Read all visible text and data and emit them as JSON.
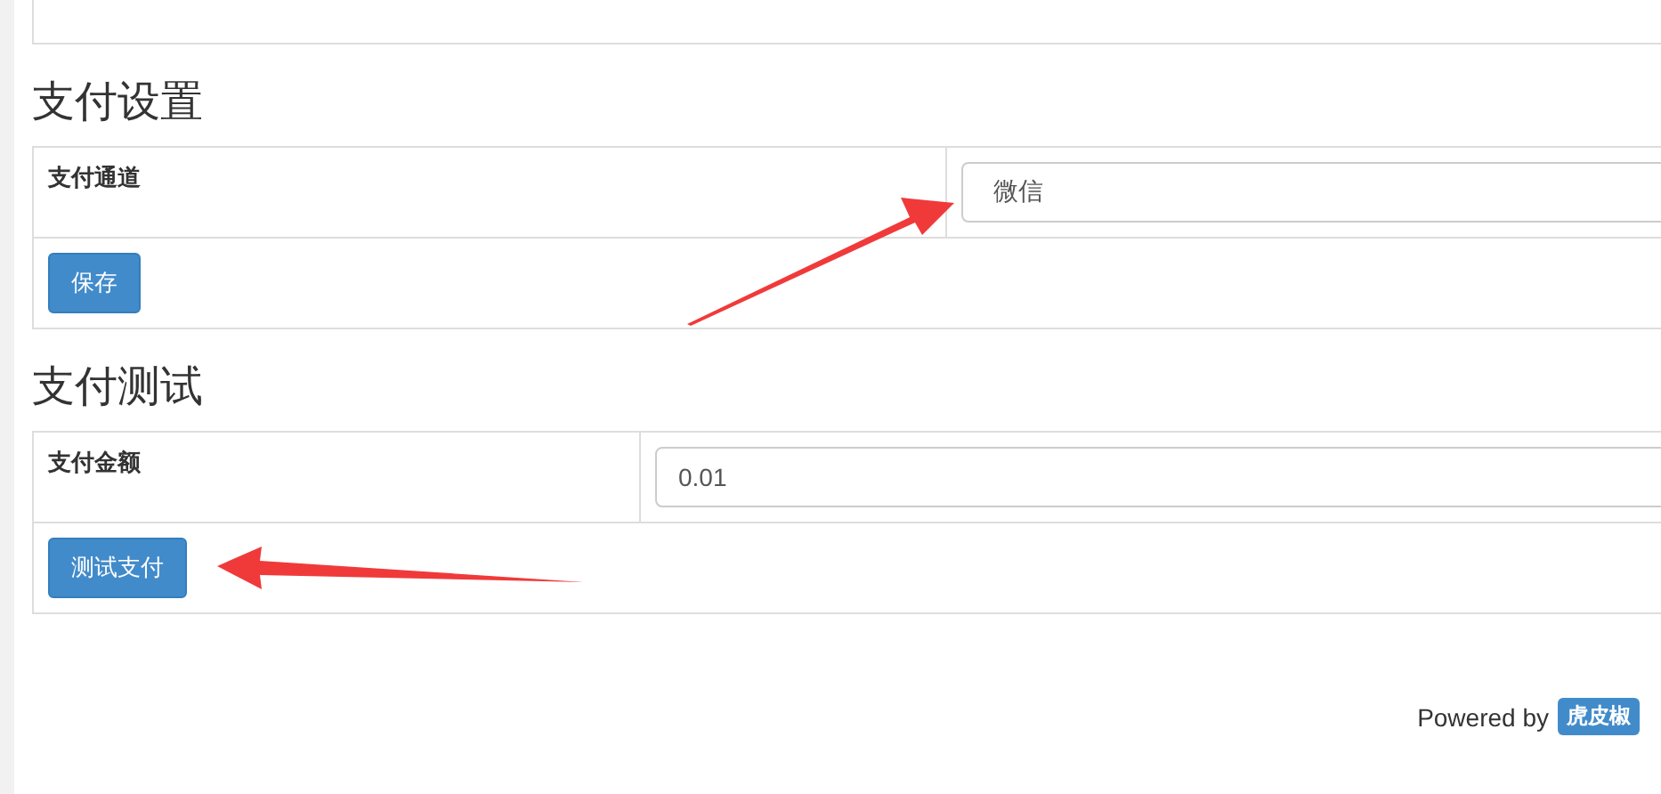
{
  "sections": [
    {
      "title": "支付设置",
      "rows": [
        {
          "label": "支付通道",
          "field": {
            "kind": "select",
            "value": "微信"
          }
        }
      ],
      "button": "保存"
    },
    {
      "title": "支付测试",
      "rows": [
        {
          "label": "支付金额",
          "field": {
            "kind": "input",
            "value": "0.01"
          }
        }
      ],
      "button": "测试支付"
    }
  ],
  "footer": {
    "text": "Powered by",
    "badge": "虎皮椒"
  }
}
